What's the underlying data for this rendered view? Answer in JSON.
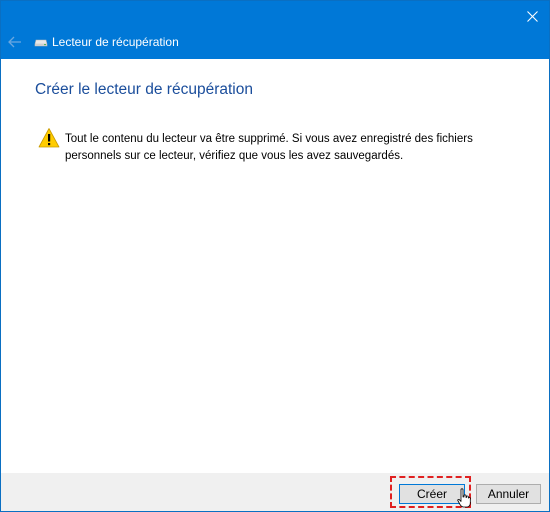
{
  "window": {
    "title": "Lecteur de récupération"
  },
  "titlebar": {
    "close_icon": "close-icon",
    "back_icon": "back-arrow-icon",
    "drive_icon": "drive-icon",
    "accent_color": "#0078d7"
  },
  "main": {
    "heading": "Créer le lecteur de récupération",
    "warning_icon": "warning-icon",
    "warning_text": "Tout le contenu du lecteur va être supprimé. Si vous avez enregistré des fichiers personnels sur ce lecteur, vérifiez que vous les avez sauvegardés."
  },
  "footer": {
    "create_label": "Créer",
    "cancel_label": "Annuler",
    "highlight_color": "#e02020"
  }
}
